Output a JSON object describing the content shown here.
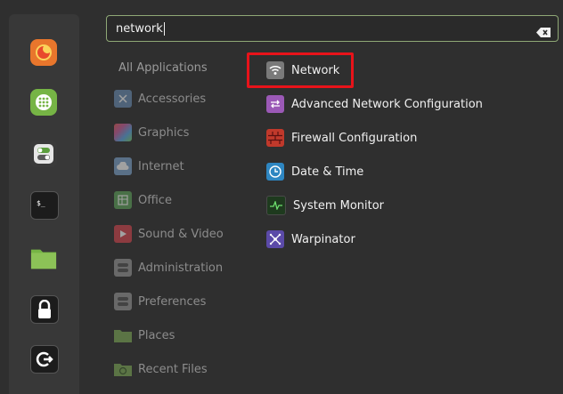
{
  "search": {
    "value": "network"
  },
  "categories": {
    "header": "All Applications",
    "items": [
      {
        "label": "Accessories",
        "icon": "scissors-icon",
        "color": "#6a8fb6"
      },
      {
        "label": "Graphics",
        "icon": "palette-icon",
        "color": "#c85fa0"
      },
      {
        "label": "Internet",
        "icon": "cloud-icon",
        "color": "#7ea6cf"
      },
      {
        "label": "Office",
        "icon": "spreadsheet-icon",
        "color": "#5fa65b"
      },
      {
        "label": "Sound & Video",
        "icon": "play-icon",
        "color": "#d9454f"
      },
      {
        "label": "Administration",
        "icon": "toggle-icon",
        "color": "#9a9a9a"
      },
      {
        "label": "Preferences",
        "icon": "toggle-icon",
        "color": "#9a9a9a"
      },
      {
        "label": "Places",
        "icon": "folder-icon",
        "color": "#7fae58"
      },
      {
        "label": "Recent Files",
        "icon": "folder-clock-icon",
        "color": "#7fae58"
      }
    ]
  },
  "results": [
    {
      "label": "Network",
      "icon": "wifi-icon",
      "color": "#7a7a7a"
    },
    {
      "label": "Advanced Network Configuration",
      "icon": "network-arrows-icon",
      "color": "#9b59b6"
    },
    {
      "label": "Firewall Configuration",
      "icon": "brick-wall-icon",
      "color": "#c0392b"
    },
    {
      "label": "Date & Time",
      "icon": "clock-icon",
      "color": "#2e86c1"
    },
    {
      "label": "System Monitor",
      "icon": "pulse-icon",
      "color": "#1e3a1e"
    },
    {
      "label": "Warpinator",
      "icon": "warp-icon",
      "color": "#5b4aa8"
    }
  ],
  "favorites": [
    {
      "name": "firefox-icon",
      "color": "#e8762c"
    },
    {
      "name": "software-manager-icon",
      "color": "#76b445"
    },
    {
      "name": "settings-toggle-icon",
      "color": "#5c9e3e"
    },
    {
      "name": "terminal-icon",
      "color": "#1c1c1c"
    },
    {
      "name": "files-folder-icon",
      "color": "#76b445"
    },
    {
      "name": "lock-screen-icon",
      "color": "#1c1c1c"
    },
    {
      "name": "logout-icon",
      "color": "#1c1c1c"
    }
  ]
}
